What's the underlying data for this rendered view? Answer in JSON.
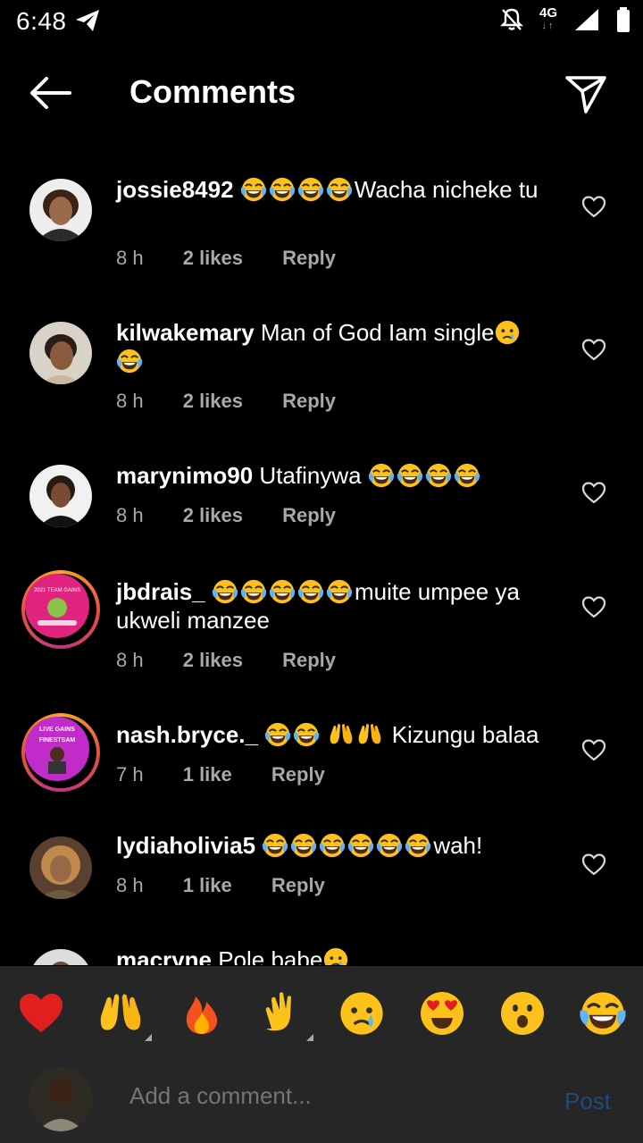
{
  "status": {
    "time": "6:48",
    "network": "4G",
    "network_arrows": "↓↑"
  },
  "header": {
    "title": "Comments"
  },
  "comments": [
    {
      "user": "jossie8492",
      "pre": "",
      "emoji_before": 4,
      "text": "Wacha nicheke tu",
      "time": "8 h",
      "likes": "2 likes",
      "reply": "Reply"
    },
    {
      "user": "kilwakemary",
      "pre": "Man of God Iam single",
      "text": "",
      "time": "8 h",
      "likes": "2 likes",
      "reply": "Reply"
    },
    {
      "user": "marynimo90",
      "pre": "Utafinywa",
      "text": "",
      "time": "8 h",
      "likes": "2 likes",
      "reply": "Reply"
    },
    {
      "user": "jbdrais_",
      "pre": "",
      "text": "muite umpee ya ukweli manzee",
      "time": "8 h",
      "likes": "2 likes",
      "reply": "Reply"
    },
    {
      "user": "nash.bryce._",
      "pre": "",
      "text": "Kizungu balaa",
      "time": "7 h",
      "likes": "1 like",
      "reply": "Reply"
    },
    {
      "user": "lydiaholivia5",
      "pre": "",
      "text": "wah!",
      "time": "8 h",
      "likes": "1 like",
      "reply": "Reply"
    },
    {
      "user": "macryne",
      "pre": "Pole babe",
      "text": ""
    }
  ],
  "avatar_text": {
    "story1": "2021 TEAM GAINS",
    "story2a": "LIVE GAINS",
    "story2b": "FINESTSAM"
  },
  "composer": {
    "placeholder": "Add a comment...",
    "post_label": "Post"
  },
  "reactions": [
    "red-heart",
    "raising-hands",
    "fire",
    "clapping-hands",
    "crying-face",
    "heart-eyes",
    "surprised-face",
    "tears-of-joy"
  ],
  "colors": {
    "background": "#000000",
    "composer_bg": "#262626",
    "post_disabled": "#1f4a7a",
    "meta_text": "#a8a8a8"
  }
}
